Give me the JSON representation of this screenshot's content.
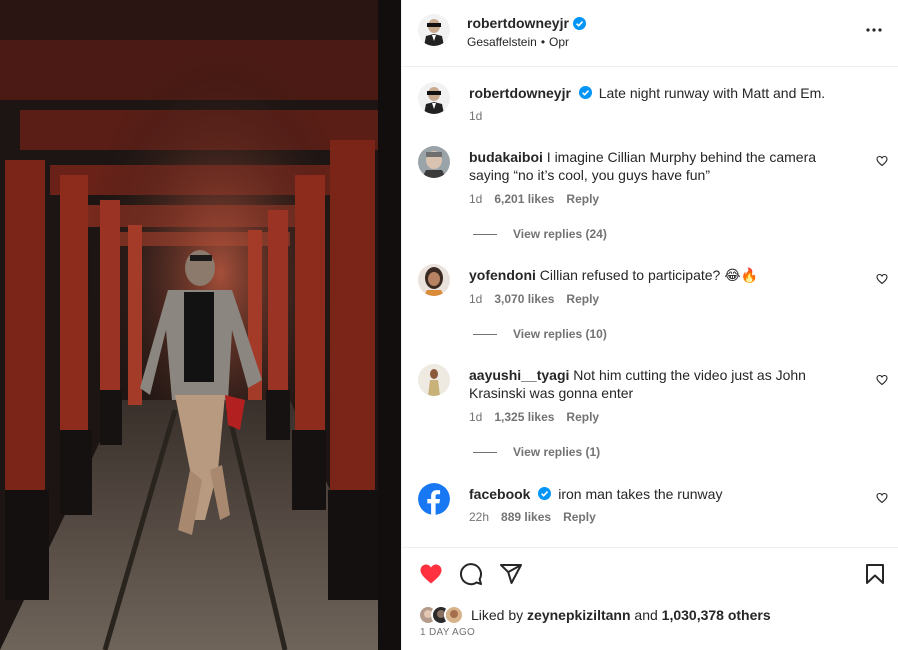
{
  "post": {
    "username": "robertdowneyjr",
    "audio": "Gesaffelstein",
    "audio_sep": "•",
    "audio_sub": "Opr"
  },
  "caption": {
    "username": "robertdowneyjr",
    "text": "Late night runway with Matt and Em.",
    "time": "1d"
  },
  "comments": [
    {
      "username": "budakaiboi",
      "text": "I imagine Cillian Murphy behind the camera saying “no it’s cool, you guys have fun”",
      "time": "1d",
      "likes": "6,201 likes",
      "reply": "Reply",
      "view_replies": "View replies (24)"
    },
    {
      "username": "yofendoni",
      "text": "Cillian refused to participate? 😂🔥",
      "time": "1d",
      "likes": "3,070 likes",
      "reply": "Reply",
      "view_replies": "View replies (10)"
    },
    {
      "username": "aayushi__tyagi",
      "text": "Not him cutting the video just as John Krasinski was gonna enter",
      "time": "1d",
      "likes": "1,325 likes",
      "reply": "Reply",
      "view_replies": "View replies (1)"
    },
    {
      "username": "facebook",
      "text": "iron man takes the runway",
      "time": "22h",
      "likes": "889 likes",
      "reply": "Reply"
    }
  ],
  "likes": {
    "prefix": "Liked by",
    "user": "zeynepkiziltann",
    "and": "and",
    "others": "1,030,378 others"
  },
  "timestamp": "1 DAY AGO",
  "colors": {
    "verified": "#0095f6",
    "liked_heart": "#ff3040",
    "facebook": "#1877f2",
    "torii_red": "#8f2a1f"
  },
  "icons": [
    "more-icon",
    "verified-icon",
    "heart-icon",
    "comment-icon",
    "share-icon",
    "save-icon"
  ]
}
